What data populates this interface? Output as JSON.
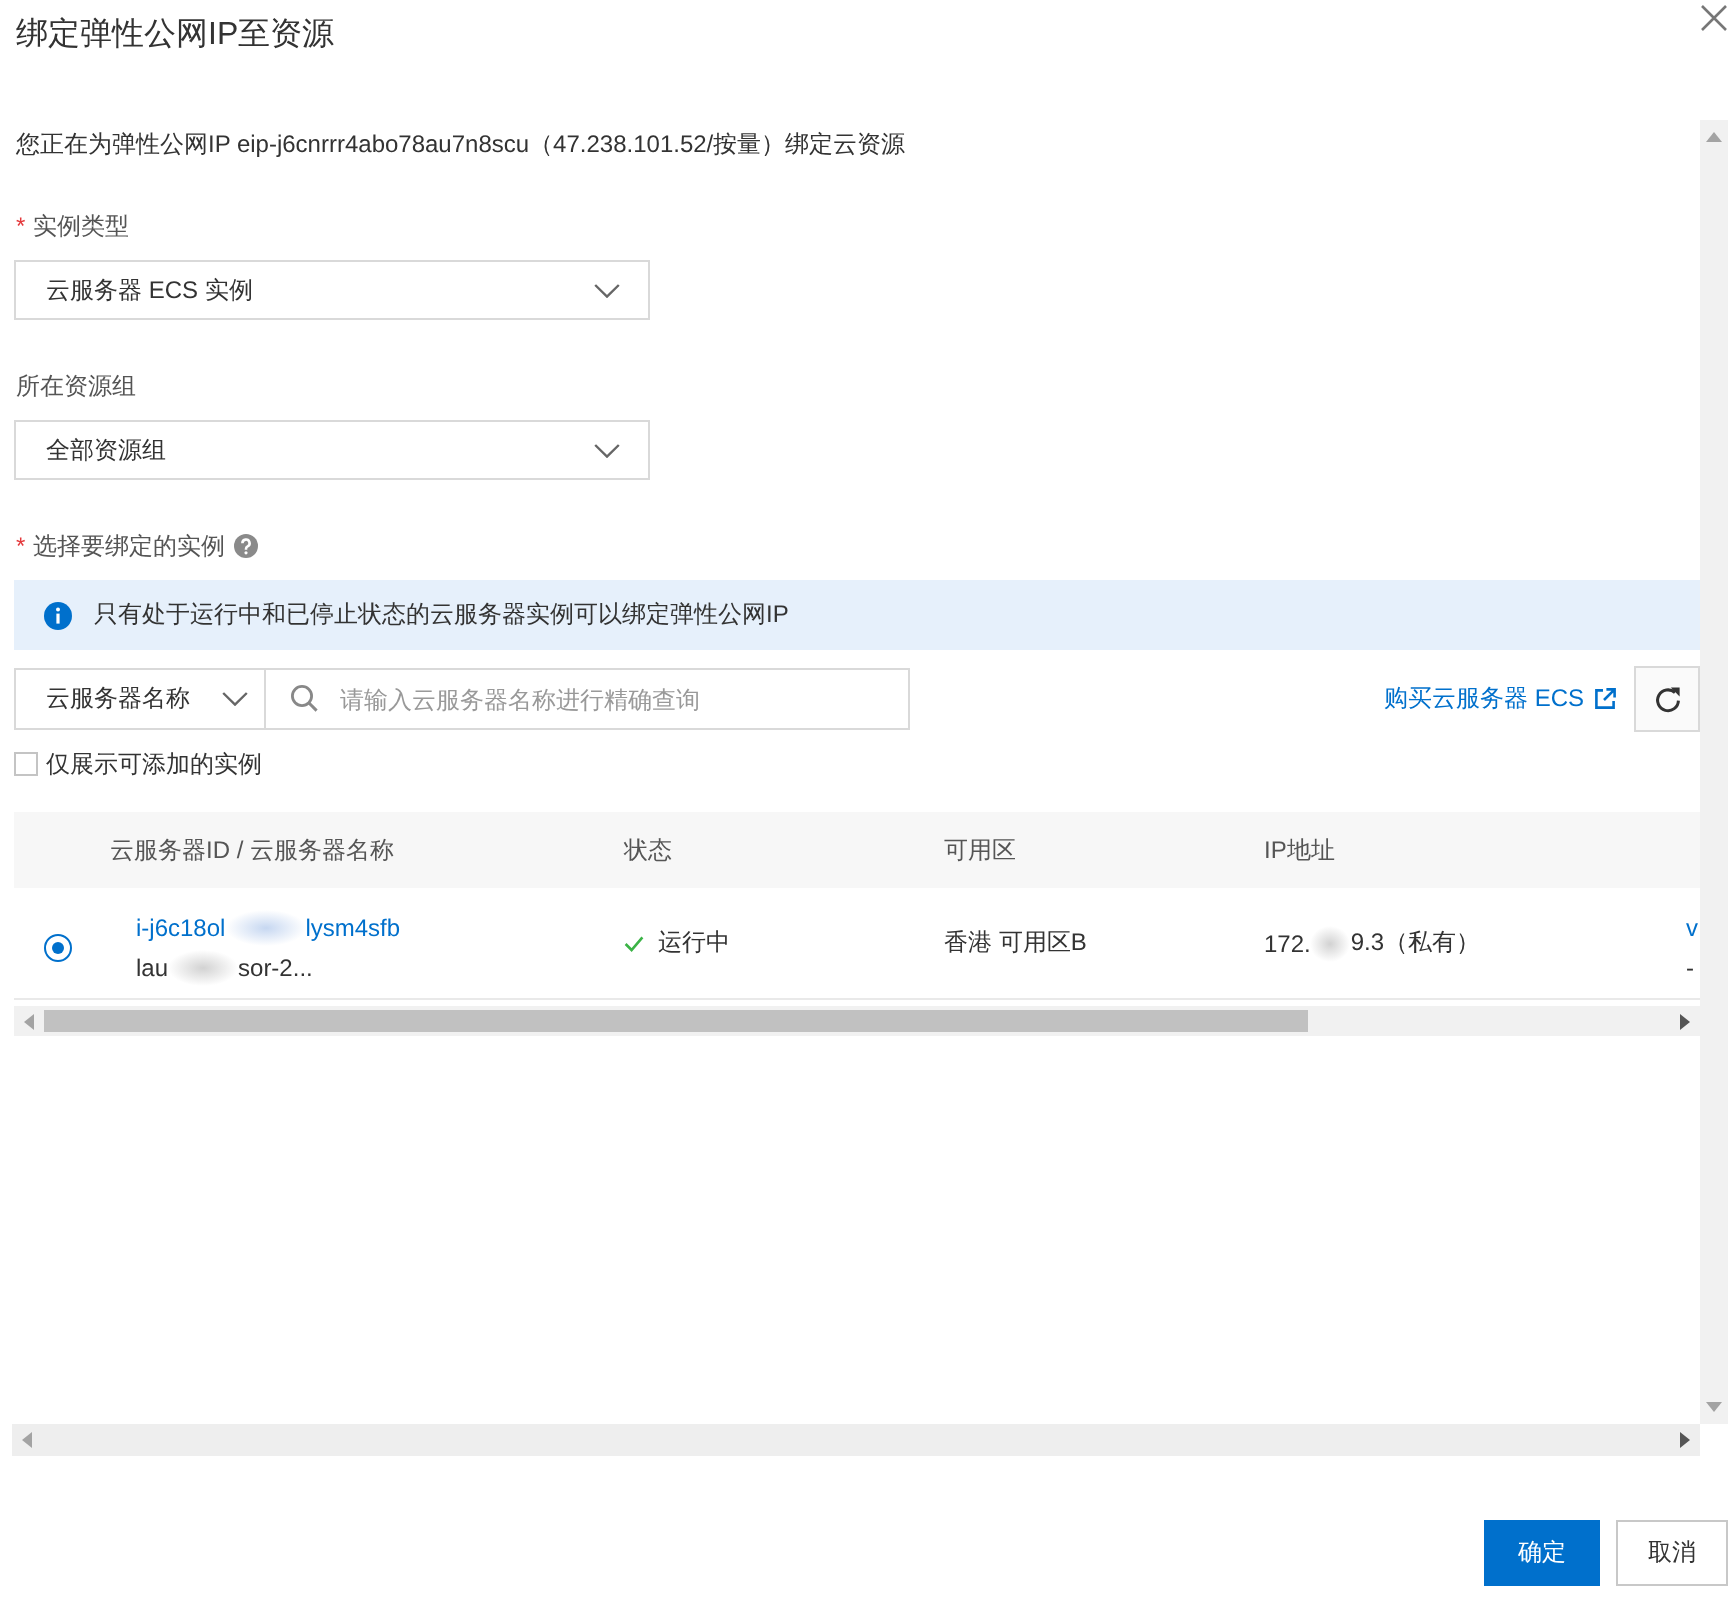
{
  "dialog": {
    "title": "绑定弹性公网IP至资源"
  },
  "intro": "您正在为弹性公网IP eip-j6cnrrr4abo78au7n8scu（47.238.101.52/按量）绑定云资源",
  "fields": [
    {
      "required_mark": "*",
      "label": "实例类型",
      "value": "云服务器 ECS 实例"
    },
    {
      "label": "所在资源组",
      "value": "全部资源组"
    }
  ],
  "instance_picker": {
    "required_mark": "*",
    "label": "选择要绑定的实例",
    "notice": "只有处于运行中和已停止状态的云服务器实例可以绑定弹性公网IP",
    "search": {
      "filter": "云服务器名称",
      "placeholder": "请输入云服务器名称进行精确查询"
    },
    "buy_link": "购买云服务器 ECS",
    "only_addable": {
      "label": "仅展示可添加的实例",
      "checked": false
    },
    "table": {
      "columns": [
        "云服务器ID / 云服务器名称",
        "状态",
        "可用区",
        "IP地址"
      ],
      "rows": [
        {
          "selected": true,
          "instance_id": [
            "i-j6c18ol",
            "lysm4sfb"
          ],
          "instance_name": [
            "lau",
            "sor-2..."
          ],
          "status": {
            "kind": "running",
            "label": "运行中"
          },
          "zone": "香港 可用区B",
          "ip_address": [
            "172.",
            "9.3（私有）"
          ],
          "column_5": [
            "v",
            "-"
          ]
        }
      ]
    }
  },
  "buttons": [
    {
      "kind": "primary",
      "label": "确定"
    },
    {
      "kind": "secondary",
      "label": "取消"
    }
  ]
}
